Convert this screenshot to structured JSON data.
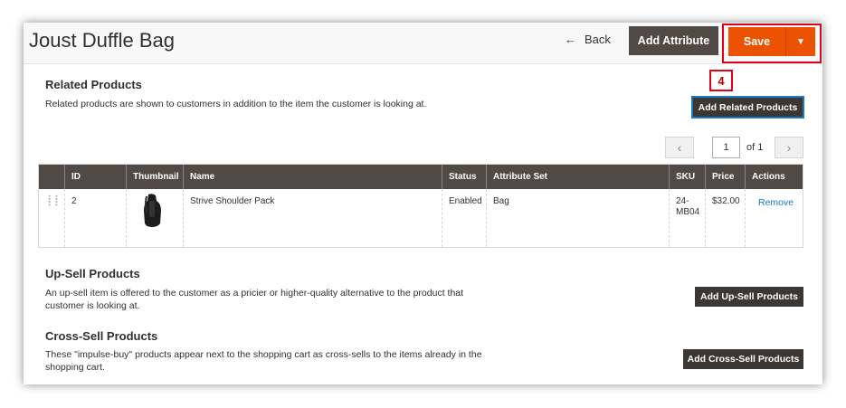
{
  "header": {
    "title": "Joust Duffle Bag",
    "back_label": "Back",
    "back_arrow": "←",
    "add_attribute_label": "Add Attribute",
    "save_label": "Save",
    "save_toggle_glyph": "▼"
  },
  "annotation": {
    "step": "4"
  },
  "related": {
    "title": "Related Products",
    "description": "Related products are shown to customers in addition to the item the customer is looking at.",
    "add_button": "Add Related Products"
  },
  "pager": {
    "prev_glyph": "‹",
    "next_glyph": "›",
    "current_page": "1",
    "of_label": "of 1"
  },
  "grid": {
    "columns": [
      "ID",
      "Thumbnail",
      "Name",
      "Status",
      "Attribute Set",
      "SKU",
      "Price",
      "Actions"
    ],
    "rows": [
      {
        "drag_glyph": "⡇⡇",
        "id": "2",
        "thumbnail_icon": "backpack-thumbnail",
        "name": "Strive Shoulder Pack",
        "status": "Enabled",
        "attribute_set": "Bag",
        "sku_line1": "24-",
        "sku_line2": "MB04",
        "price": "$32.00",
        "action": "Remove"
      }
    ]
  },
  "upsell": {
    "title": "Up-Sell Products",
    "description_line1": "An up-sell item is offered to the customer as a pricier or higher-quality alternative to the product that",
    "description_line2": "customer is looking at.",
    "add_button": "Add Up-Sell Products"
  },
  "crosssell": {
    "title": "Cross-Sell Products",
    "description_line1": "These \"impulse-buy\" products appear next to the shopping cart as cross-sells to the items already in the",
    "description_line2": "shopping cart.",
    "add_button": "Add Cross-Sell Products"
  },
  "colors": {
    "save_orange": "#eb5202",
    "dark_button": "#514943",
    "highlight_red": "#e0001b",
    "link_blue": "#1979c3"
  }
}
